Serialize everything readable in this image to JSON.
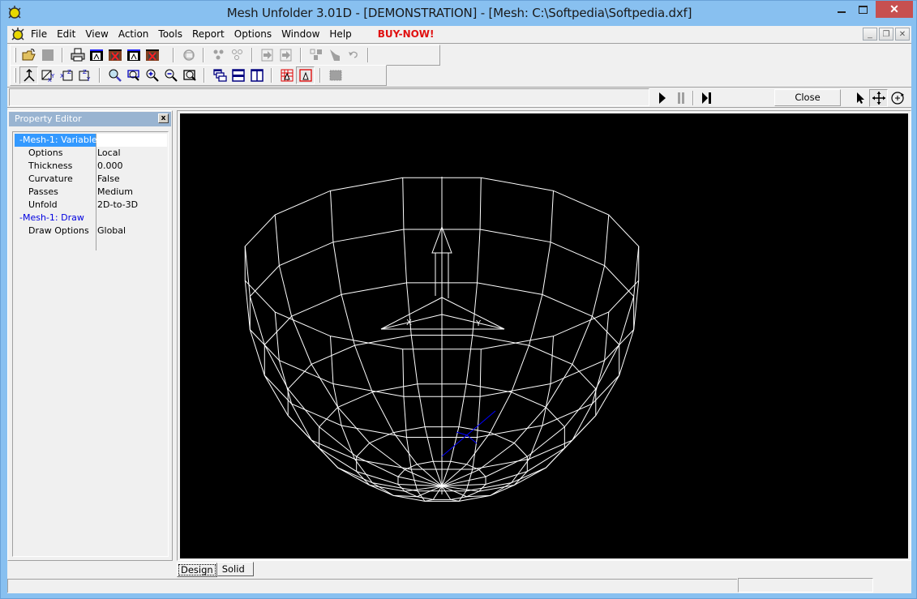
{
  "window": {
    "title": "Mesh Unfolder 3.01D - [DEMONSTRATION] - [Mesh: C:\\Softpedia\\Softpedia.dxf]",
    "controls": {
      "minimize": "–",
      "maximize": "☐",
      "close": "✕"
    }
  },
  "menu": {
    "items": [
      "File",
      "Edit",
      "View",
      "Action",
      "Tools",
      "Report",
      "Options",
      "Window",
      "Help"
    ],
    "buy": "BUY-NOW!",
    "buy_color": "#e01010",
    "mdi": {
      "minimize": "_",
      "restore": "❐",
      "close": "✕"
    }
  },
  "toolbar1": {
    "groups": [
      [
        "open-icon",
        "save-icon"
      ],
      [
        "print-icon",
        "export-a-icon",
        "export-x-icon",
        "export-a2-icon",
        "export-x2-icon"
      ],
      [
        "render-icon"
      ],
      [
        "vertices-on-icon",
        "vertices-off-icon"
      ],
      [
        "step-in-icon",
        "step-out-icon"
      ],
      [
        "connect-icon",
        "fill-icon",
        "undo-icon"
      ]
    ]
  },
  "toolbar2": {
    "groups": [
      [
        "view-top-icon",
        "view-xy-icon",
        "view-xz-icon",
        "view-yz-icon"
      ],
      [
        "zoom-icon",
        "zoom-window-icon",
        "zoom-in-icon",
        "zoom-out-icon",
        "zoom-extents-icon"
      ],
      [
        "cascade-icon",
        "tile-horizontal-icon",
        "tile-vertical-icon"
      ],
      [
        "grid-pen-icon",
        "pen-frame-icon"
      ],
      [
        "solid-gray-icon"
      ]
    ]
  },
  "animation": {
    "play": "play-icon",
    "pause": "pause-icon",
    "step": "step-end-icon",
    "close_label": "Close"
  },
  "cursor_tools": [
    "pointer-icon",
    "pan-icon",
    "rotate-icon"
  ],
  "property_editor": {
    "title": "Property Editor",
    "close": "x",
    "rows": [
      {
        "name": "-Mesh-1: Variable",
        "value": "",
        "type": "group-selected"
      },
      {
        "name": "Options",
        "value": "Local",
        "type": "prop"
      },
      {
        "name": "Thickness",
        "value": "0.000",
        "type": "prop"
      },
      {
        "name": "Curvature",
        "value": "False",
        "type": "prop"
      },
      {
        "name": "Passes",
        "value": "Medium",
        "type": "prop"
      },
      {
        "name": "Unfold",
        "value": "2D-to-3D",
        "type": "prop"
      },
      {
        "name": "-Mesh-1: Draw",
        "value": "",
        "type": "group"
      },
      {
        "name": "Draw Options",
        "value": "Global",
        "type": "prop"
      }
    ]
  },
  "viewport": {
    "background": "#000000",
    "wire_color": "#ffffff",
    "axis_color": "#0000ff",
    "axis_labels": [
      "X",
      "Y"
    ]
  },
  "tabs": [
    {
      "label": "Design",
      "active": true
    },
    {
      "label": "Solid",
      "active": false
    }
  ],
  "status": {
    "main": "",
    "right": ""
  }
}
